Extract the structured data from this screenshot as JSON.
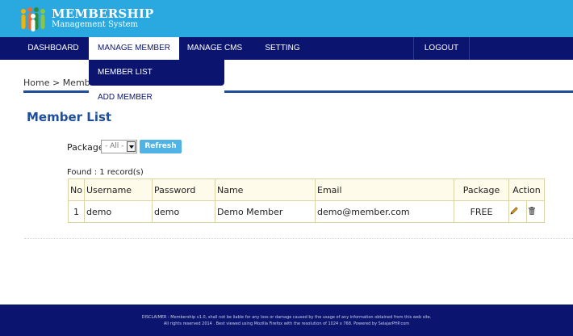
{
  "header": {
    "brand_title": "MEMBERSHIP",
    "brand_subtitle": "Management System"
  },
  "nav": {
    "items": [
      {
        "label": "DASHBOARD"
      },
      {
        "label": "MANAGE MEMBER"
      },
      {
        "label": "MANAGE CMS"
      },
      {
        "label": "SETTING"
      },
      {
        "label": "LOGOUT"
      }
    ]
  },
  "dropdown": {
    "items": [
      {
        "label": "MEMBER LIST"
      },
      {
        "label": "ADD MEMBER"
      }
    ]
  },
  "breadcrumb": "Home > Member",
  "page_title": "Member List",
  "filter": {
    "package_label": "Package",
    "selected": "- All -",
    "refresh_label": "Refresh"
  },
  "found_text": "Found : 1 record(s)",
  "table": {
    "headers": [
      "No",
      "Username",
      "Password",
      "Name",
      "Email",
      "Package",
      "Action"
    ],
    "rows": [
      {
        "no": "1",
        "username": "demo",
        "password": "demo",
        "name": "Demo Member",
        "email": "demo@member.com",
        "package": "FREE"
      }
    ]
  },
  "footer": {
    "line1": "DISCLAIMER : Membership v1.0, shall not be liable for any loss or damage caused by the usage of any information obtained from this web site.",
    "line2": "All rights reserved 2014 . Best viewed using Mozilla Firefox with the resolution of 1024 x 768. Powered by SelajarPHP.com"
  },
  "colors": {
    "header_bg": "#29a9e0",
    "nav_bg": "#0b1570",
    "title_blue": "#1f4e9c",
    "refresh_btn": "#4fb3e6"
  }
}
